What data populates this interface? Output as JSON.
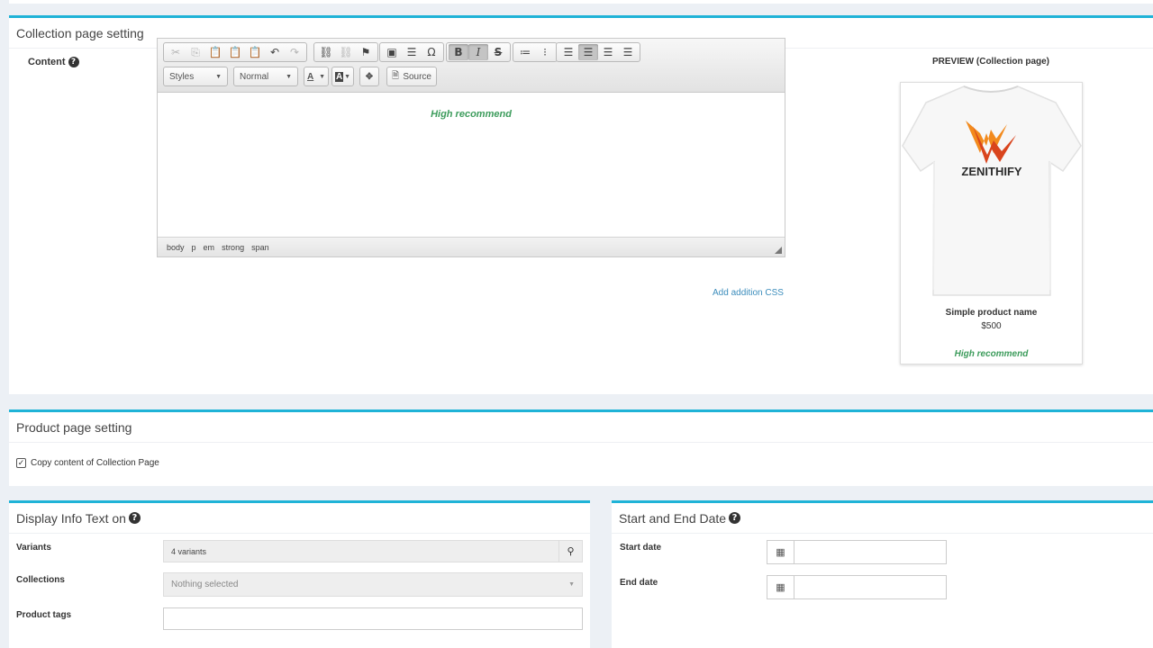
{
  "collection": {
    "title": "Collection page setting",
    "content_label": "Content",
    "styles_combo": "Styles",
    "format_combo": "Normal",
    "source_label": "Source",
    "editor_text": "High recommend",
    "path": [
      "body",
      "p",
      "em",
      "strong",
      "span"
    ],
    "add_css_link": "Add addition CSS"
  },
  "preview": {
    "title": "PREVIEW (Collection page)",
    "brand": "ZENITHIFY",
    "product_name": "Simple product name",
    "price": "$500",
    "badge_text": "High recommend",
    "badge_color": "#3d9c5c"
  },
  "product": {
    "title": "Product page setting",
    "copy_label": "Copy content of Collection Page",
    "copy_checked": true
  },
  "display": {
    "title": "Display Info Text on",
    "variants_label": "Variants",
    "variants_value": "4 variants",
    "collections_label": "Collections",
    "collections_placeholder": "Nothing selected",
    "tags_label": "Product tags"
  },
  "dates": {
    "title": "Start and End Date",
    "start_label": "Start date",
    "end_label": "End date"
  },
  "icons": [
    "cut-icon",
    "copy-icon",
    "paste-icon",
    "undo-icon",
    "redo-icon",
    "link-icon",
    "image-icon",
    "bold-icon",
    "italic-icon",
    "calendar-icon",
    "search-icon"
  ],
  "accent_color": "#1fb3d7"
}
